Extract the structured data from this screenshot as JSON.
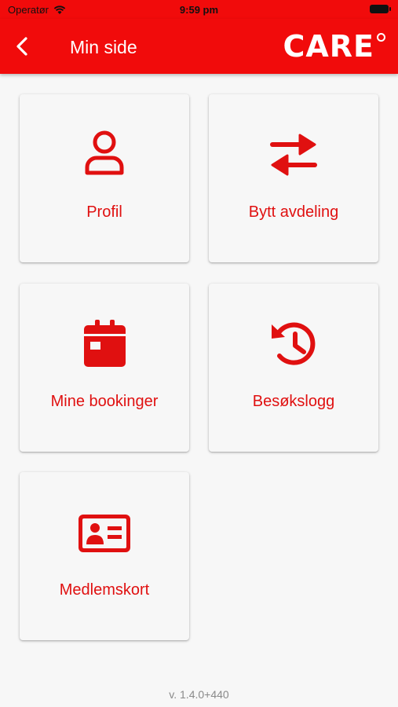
{
  "statusbar": {
    "carrier": "Operatør",
    "time": "9:59 pm"
  },
  "header": {
    "title": "Min side",
    "logo": "CARE"
  },
  "tiles": [
    {
      "label": "Profil",
      "icon": "person-icon"
    },
    {
      "label": "Bytt avdeling",
      "icon": "swap-arrows-icon"
    },
    {
      "label": "Mine bookinger",
      "icon": "calendar-icon"
    },
    {
      "label": "Besøkslogg",
      "icon": "history-icon"
    },
    {
      "label": "Medlemskort",
      "icon": "id-card-icon"
    }
  ],
  "footer": {
    "version": "v. 1.4.0+440"
  },
  "colors": {
    "brand_red": "#f10b0b",
    "tile_text": "#e01010",
    "background": "#f7f7f7"
  }
}
